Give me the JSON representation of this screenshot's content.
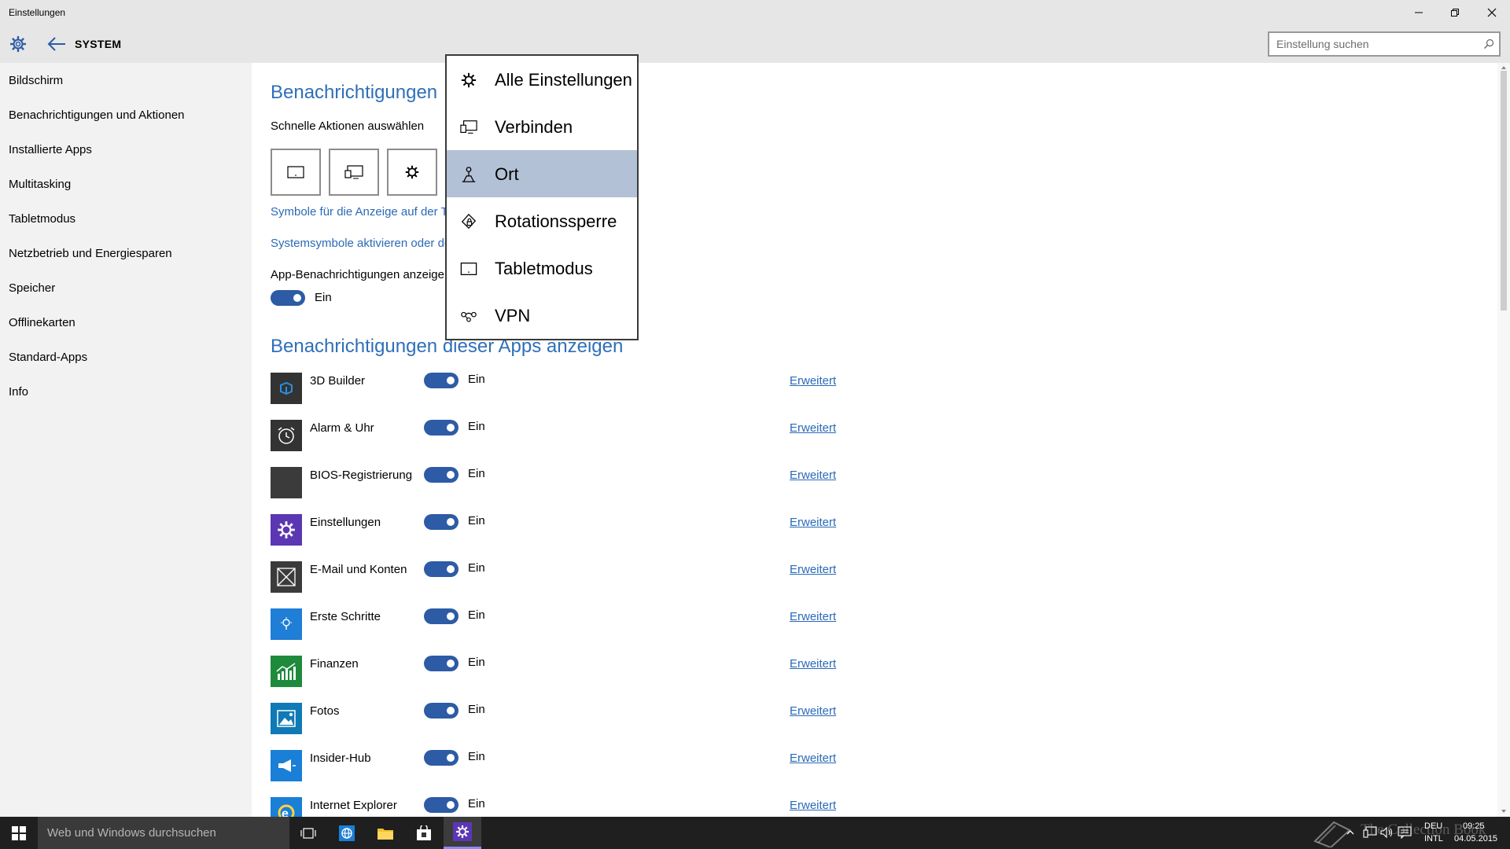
{
  "window": {
    "title": "Einstellungen",
    "minimize_icon": "minimize-icon",
    "restore_icon": "restore-icon",
    "close_icon": "close-icon"
  },
  "header": {
    "section": "SYSTEM",
    "search_placeholder": "Einstellung suchen"
  },
  "sidebar": {
    "items": [
      {
        "label": "Bildschirm"
      },
      {
        "label": "Benachrichtigungen und Aktionen"
      },
      {
        "label": "Installierte Apps"
      },
      {
        "label": "Multitasking"
      },
      {
        "label": "Tabletmodus"
      },
      {
        "label": "Netzbetrieb und Energiesparen"
      },
      {
        "label": "Speicher"
      },
      {
        "label": "Offlinekarten"
      },
      {
        "label": "Standard-Apps"
      },
      {
        "label": "Info"
      }
    ]
  },
  "main": {
    "heading": "Benachrichtigungen",
    "quick_actions_label": "Schnelle Aktionen auswählen",
    "link_taskbar_icons": "Symbole für die Anzeige auf der T",
    "link_system_icons": "Systemsymbole aktivieren oder de",
    "app_notifications_label": "App-Benachrichtigungen anzeige",
    "app_notifications_state": "Ein",
    "apps_heading": "Benachrichtigungen dieser Apps anzeigen",
    "apps": [
      {
        "name": "3D Builder",
        "state": "Ein",
        "link": "Erweitert",
        "icon": "3d-builder-icon",
        "color": "#333333"
      },
      {
        "name": "Alarm & Uhr",
        "state": "Ein",
        "link": "Erweitert",
        "icon": "alarm-clock-icon",
        "color": "#333333"
      },
      {
        "name": "BIOS-Registrierung",
        "state": "Ein",
        "link": "Erweitert",
        "icon": "bios-icon",
        "color": "#3b3b3b"
      },
      {
        "name": "Einstellungen",
        "state": "Ein",
        "link": "Erweitert",
        "icon": "settings-gear-icon",
        "color": "#5b37b3"
      },
      {
        "name": "E-Mail und Konten",
        "state": "Ein",
        "link": "Erweitert",
        "icon": "mail-icon",
        "color": "#3b3b3b"
      },
      {
        "name": "Erste Schritte",
        "state": "Ein",
        "link": "Erweitert",
        "icon": "lightbulb-icon",
        "color": "#1f7ed6"
      },
      {
        "name": "Finanzen",
        "state": "Ein",
        "link": "Erweitert",
        "icon": "finance-chart-icon",
        "color": "#1e8a3c"
      },
      {
        "name": "Fotos",
        "state": "Ein",
        "link": "Erweitert",
        "icon": "photos-icon",
        "color": "#0f7ab5"
      },
      {
        "name": "Insider-Hub",
        "state": "Ein",
        "link": "Erweitert",
        "icon": "megaphone-icon",
        "color": "#1a7fd6"
      },
      {
        "name": "Internet Explorer",
        "state": "Ein",
        "link": "Erweitert",
        "icon": "internet-explorer-icon",
        "color": "#1a7fd6"
      }
    ]
  },
  "popup": {
    "items": [
      {
        "label": "Alle Einstellungen",
        "icon": "gear-icon"
      },
      {
        "label": "Verbinden",
        "icon": "connect-icon"
      },
      {
        "label": "Ort",
        "icon": "location-icon",
        "selected": true
      },
      {
        "label": "Rotationssperre",
        "icon": "rotation-lock-icon"
      },
      {
        "label": "Tabletmodus",
        "icon": "tablet-mode-icon"
      },
      {
        "label": "VPN",
        "icon": "vpn-icon"
      }
    ]
  },
  "taskbar": {
    "search_placeholder": "Web und Windows durchsuchen",
    "language_top": "DEU",
    "language_bottom": "INTL",
    "time": "09:25",
    "date": "04.05.2015",
    "watermark": "The Collection Book"
  },
  "colors": {
    "accent": "#2e6fb8",
    "toggle_on": "#2d5ba5",
    "popup_selected": "#b3c1d6",
    "link": "#2a6ab7"
  }
}
